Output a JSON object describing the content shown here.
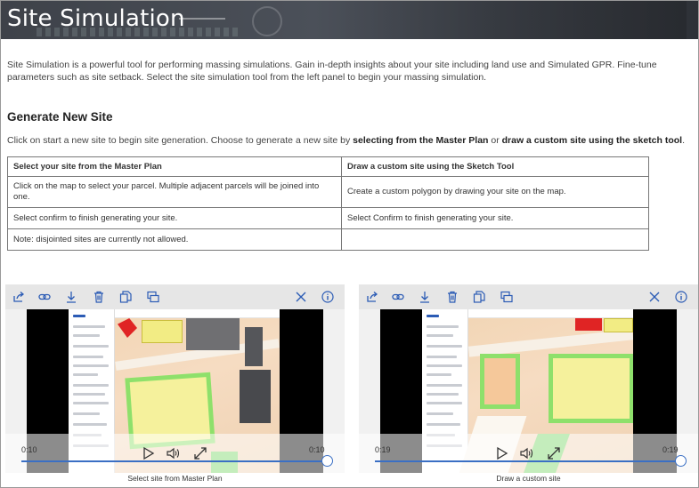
{
  "header": {
    "title": "Site Simulation",
    "background": "#44484f"
  },
  "intro": "Site Simulation is a powerful tool for performing massing simulations. Gain in-depth insights about your site including land use and Simulated GPR. Fine-tune parameters such as site setback. Select the site simulation tool from the left panel to begin your massing simulation.",
  "generate": {
    "title": "Generate New Site",
    "desc_prefix": "Click on start a new site to begin site generation. Choose to generate a new site by ",
    "desc_bold1": "selecting from the Master Plan",
    "desc_mid": " or ",
    "desc_bold2": "draw a custom site using the sketch tool",
    "desc_suffix": "."
  },
  "table": {
    "headers": [
      "Select your site from the Master Plan",
      "Draw a custom site using the Sketch Tool"
    ],
    "rows": [
      [
        "Click on the map to select your parcel. Multiple adjacent parcels will be joined into one.",
        "Create a custom polygon by drawing your site on the map."
      ],
      [
        "Select confirm to finish generating your site.",
        "Select Confirm to finish generating your site."
      ],
      [
        "Note: disjointed sites are currently not allowed.",
        ""
      ]
    ]
  },
  "toolbar_icons": [
    "share-icon",
    "link-icon",
    "download-icon",
    "delete-icon",
    "copy-icon",
    "embed-icon",
    "close-icon",
    "info-icon"
  ],
  "videos": [
    {
      "caption": "Select site from Master Plan",
      "time_left": "0:10",
      "time_right": "0:10",
      "progress": 1.0
    },
    {
      "caption": "Draw a custom site",
      "time_left": "0:19",
      "time_right": "0:19",
      "progress": 1.0
    }
  ],
  "colors": {
    "accent": "#2b5bb5",
    "seek": "#3a6fc4",
    "parcel_fill": "#f5f19c",
    "parcel_border": "#8ee06b",
    "map": "#f2d6b6"
  }
}
